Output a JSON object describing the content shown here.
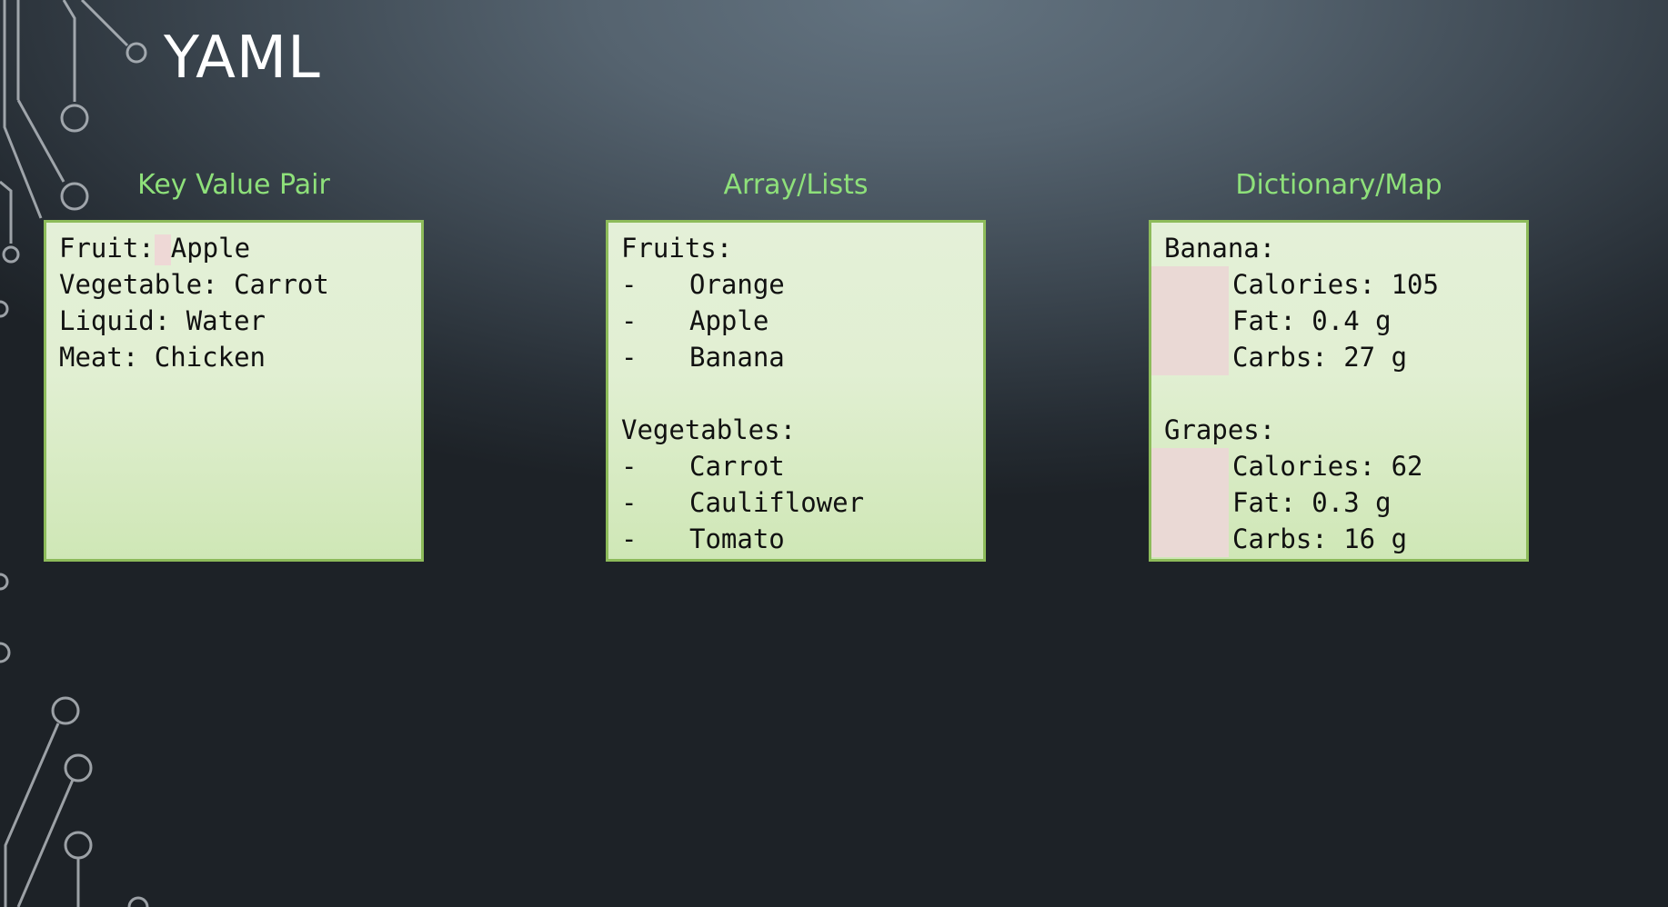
{
  "title": "YAML",
  "sections": [
    {
      "heading": "Key Value Pair",
      "lines": [
        {
          "key": "Fruit:",
          "value": "Apple"
        },
        {
          "key": "Vegetable:",
          "value": "Carrot"
        },
        {
          "key": "Liquid:",
          "value": "Water"
        },
        {
          "key": "Meat:",
          "value": "Chicken"
        }
      ]
    },
    {
      "heading": "Array/Lists",
      "groups": [
        {
          "key": "Fruits:",
          "items": [
            "Orange",
            "Apple",
            "Banana"
          ]
        },
        {
          "key": "Vegetables:",
          "items": [
            "Carrot",
            "Cauliflower",
            "Tomato"
          ]
        }
      ],
      "dash": "-"
    },
    {
      "heading": "Dictionary/Map",
      "groups": [
        {
          "key": "Banana:",
          "props": [
            "Calories: 105",
            "Fat: 0.4 g",
            "Carbs: 27 g"
          ]
        },
        {
          "key": "Grapes:",
          "props": [
            "Calories: 62",
            "Fat: 0.3 g",
            "Carbs: 16 g"
          ]
        }
      ]
    }
  ],
  "colors": {
    "heading": "#8ee07a",
    "box_border": "#8dbb5a",
    "box_fill": "#e1efd2",
    "background": "#4a5660"
  }
}
